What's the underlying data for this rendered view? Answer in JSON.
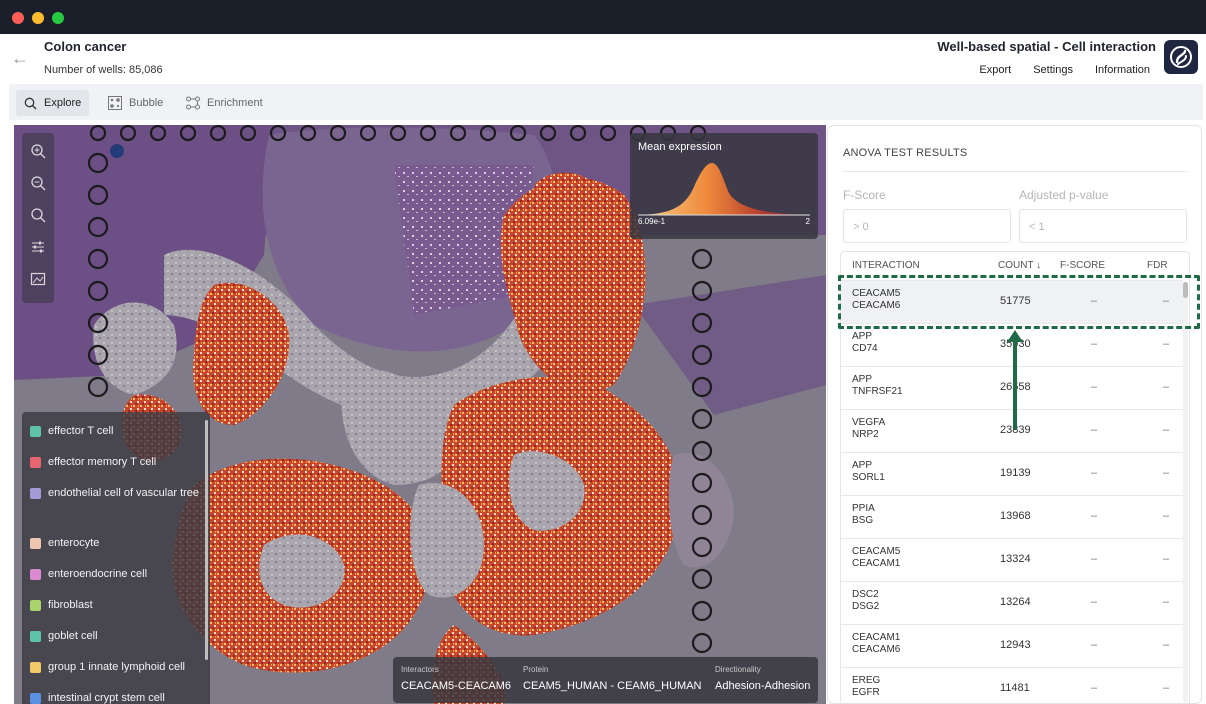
{
  "project": {
    "title": "Colon cancer",
    "subtitle": "Number of wells: 85,086"
  },
  "page": {
    "title": "Well-based spatial - Cell interaction"
  },
  "top_links": [
    "Export",
    "Settings",
    "Information"
  ],
  "tabs": [
    {
      "label": "Explore",
      "icon": "search-icon"
    },
    {
      "label": "Bubble",
      "icon": "bubble-grid-icon"
    },
    {
      "label": "Enrichment",
      "icon": "enrichment-icon"
    }
  ],
  "viewer": {
    "tools": [
      "zoom-in-icon",
      "zoom-out-icon",
      "zoom-reset-icon",
      "adjust-sliders-icon",
      "image-icon"
    ],
    "expression": {
      "title": "Mean expression",
      "min": "6.09e-1",
      "max": "2"
    },
    "legend": [
      {
        "label": "effector T cell",
        "color": "#5fc3a8"
      },
      {
        "label": "effector memory T cell",
        "color": "#e76470"
      },
      {
        "label": "endothelial cell of vascular tree",
        "color": "#a49ad8"
      },
      {
        "label": "enterocyte",
        "color": "#eec6b0"
      },
      {
        "label": "enteroendocrine cell",
        "color": "#d98ad0"
      },
      {
        "label": "fibroblast",
        "color": "#a8d36a"
      },
      {
        "label": "goblet cell",
        "color": "#5fc3a8"
      },
      {
        "label": "group 1 innate lymphoid cell",
        "color": "#f2c868"
      },
      {
        "label": "intestinal crypt stem cell",
        "color": "#5b8fe0"
      }
    ],
    "info": {
      "interactors_label": "Interactors",
      "interactors_value": "CEACAM5-CEACAM6",
      "protein_label": "Protein",
      "protein_value": "CEAM5_HUMAN - CEAM6_HUMAN",
      "directionality_label": "Directionality",
      "directionality_value": "Adhesion-Adhesion"
    }
  },
  "results": {
    "title": "ANOVA TEST RESULTS",
    "fscore_label": "F-Score",
    "fscore_placeholder": "> 0",
    "pvalue_label": "Adjusted p-value",
    "pvalue_placeholder": "< 1",
    "columns": [
      "INTERACTION",
      "COUNT ↓",
      "F-SCORE",
      "FDR"
    ],
    "rows": [
      {
        "a": "CEACAM5",
        "b": "CEACAM6",
        "count": "51775",
        "fscore": "–",
        "fdr": "–"
      },
      {
        "a": "APP",
        "b": "CD74",
        "count": "35930",
        "fscore": "–",
        "fdr": "–"
      },
      {
        "a": "APP",
        "b": "TNFRSF21",
        "count": "26558",
        "fscore": "–",
        "fdr": "–"
      },
      {
        "a": "VEGFA",
        "b": "NRP2",
        "count": "23839",
        "fscore": "–",
        "fdr": "–"
      },
      {
        "a": "APP",
        "b": "SORL1",
        "count": "19139",
        "fscore": "–",
        "fdr": "–"
      },
      {
        "a": "PPIA",
        "b": "BSG",
        "count": "13968",
        "fscore": "–",
        "fdr": "–"
      },
      {
        "a": "CEACAM5",
        "b": "CEACAM1",
        "count": "13324",
        "fscore": "–",
        "fdr": "–"
      },
      {
        "a": "DSC2",
        "b": "DSG2",
        "count": "13264",
        "fscore": "–",
        "fdr": "–"
      },
      {
        "a": "CEACAM1",
        "b": "CEACAM6",
        "count": "12943",
        "fscore": "–",
        "fdr": "–"
      },
      {
        "a": "EREG",
        "b": "EGFR",
        "count": "11481",
        "fscore": "–",
        "fdr": "–"
      }
    ]
  },
  "colors": {
    "accent": "#1f6b45",
    "window_bar": "#1b1f2a",
    "selected_row": "#f0f1f4"
  }
}
